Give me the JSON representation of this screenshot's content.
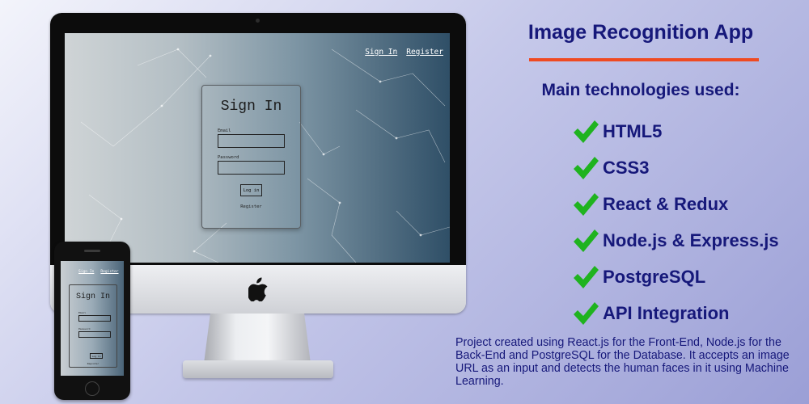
{
  "app": {
    "nav": {
      "sign_in": "Sign In",
      "register": "Register"
    },
    "form": {
      "title": "Sign In",
      "email_label": "Email",
      "password_label": "Password",
      "login_button": "Log in",
      "register_link": "Register"
    }
  },
  "colors": {
    "heading": "#16187a",
    "accent_underline": "#ef4a22",
    "checkmark": "#1fb31f"
  },
  "panel": {
    "title": "Image Recognition App",
    "subtitle": "Main technologies used:",
    "technologies": [
      "HTML5",
      "CSS3",
      "React & Redux",
      "Node.js & Express.js",
      "PostgreSQL",
      "API Integration"
    ],
    "check_icon": "checkmark-icon",
    "description": "Project created using React.js for the Front-End, Node.js for the Back-End and PostgreSQL for the Database. It accepts an image URL as an input and detects the human faces in it using Machine Learning."
  },
  "devices": {
    "desktop_logo_icon": "apple-logo-icon"
  }
}
